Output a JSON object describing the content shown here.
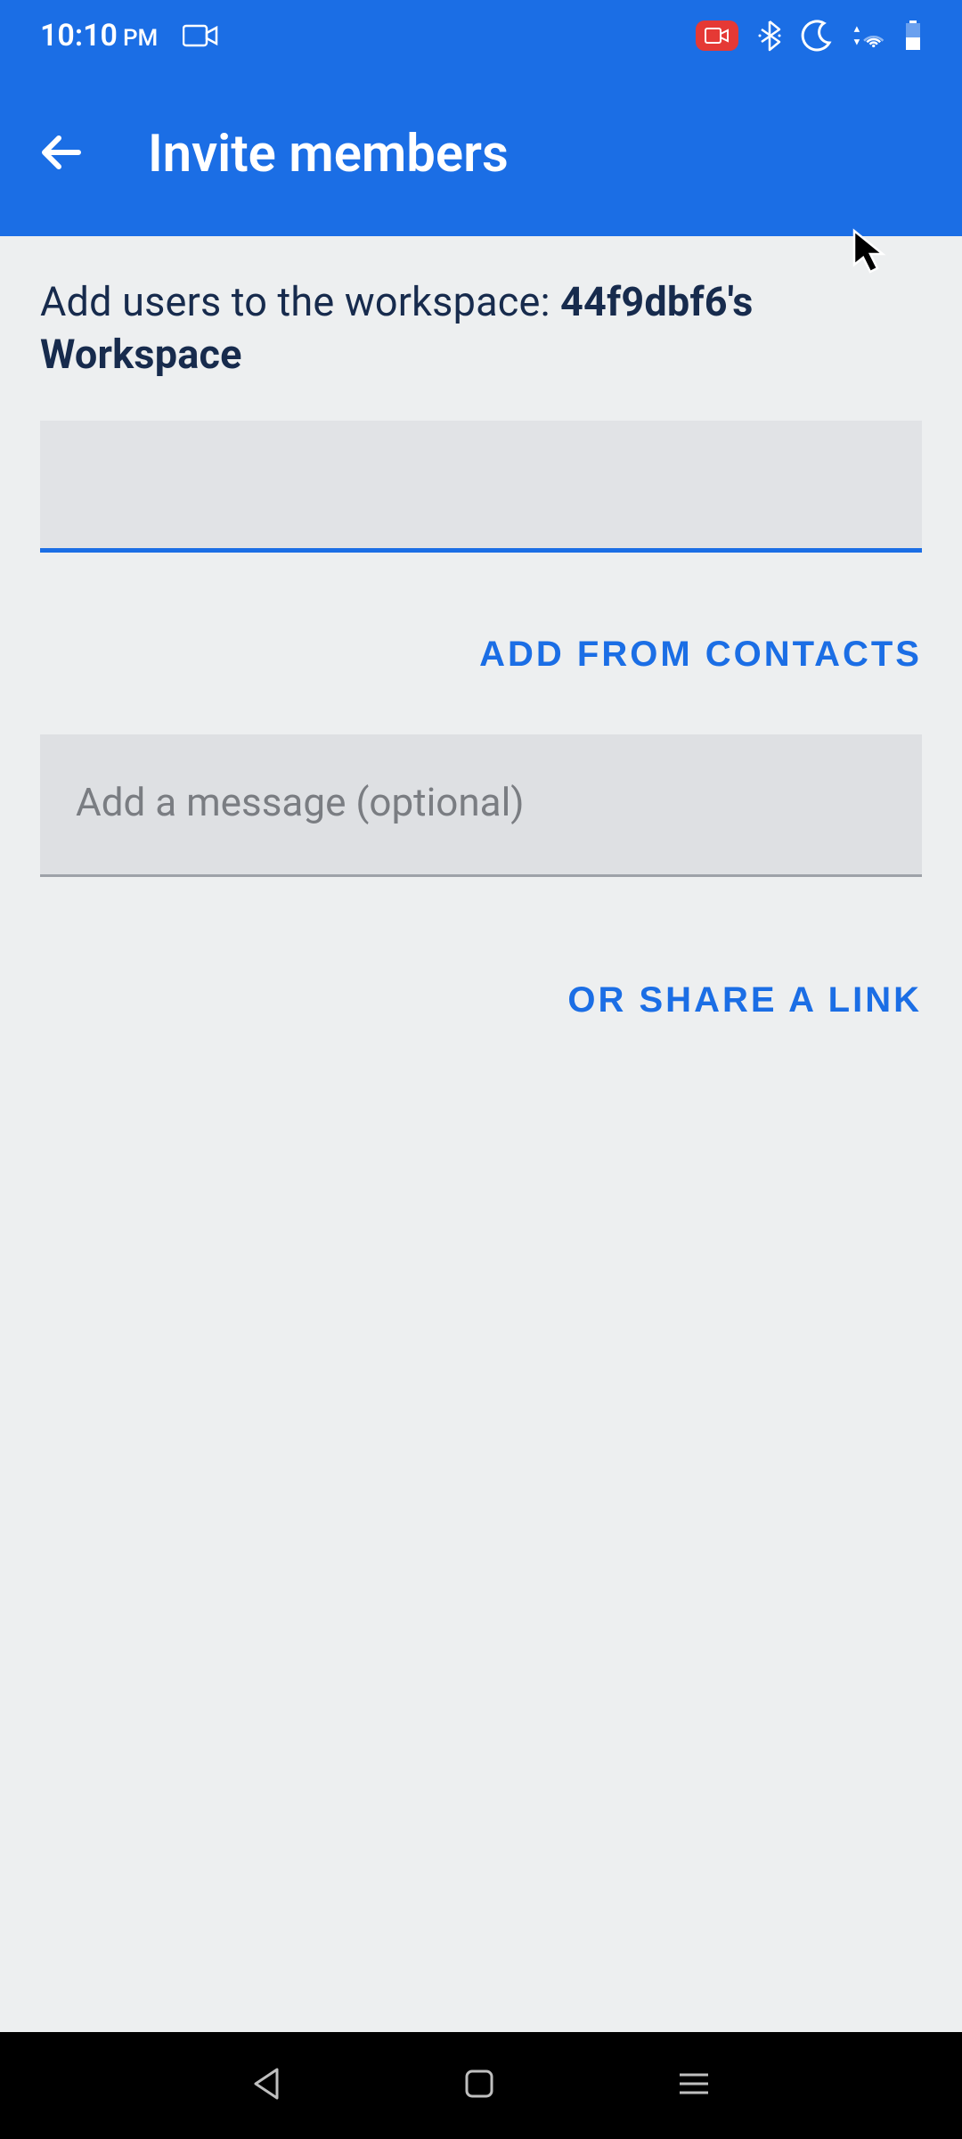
{
  "status_bar": {
    "time": "10:10",
    "ampm": "PM"
  },
  "app_bar": {
    "title": "Invite members"
  },
  "content": {
    "prompt_prefix": "Add users to the workspace: ",
    "workspace_name": "44f9dbf6's Workspace",
    "user_input_value": "",
    "add_from_contacts": "ADD FROM CONTACTS",
    "message_placeholder": "Add a message (optional)",
    "message_value": "",
    "share_link": "OR SHARE A LINK"
  },
  "colors": {
    "primary": "#1b6ee5",
    "bg": "#edeff0",
    "text_dark": "#172b4d"
  }
}
